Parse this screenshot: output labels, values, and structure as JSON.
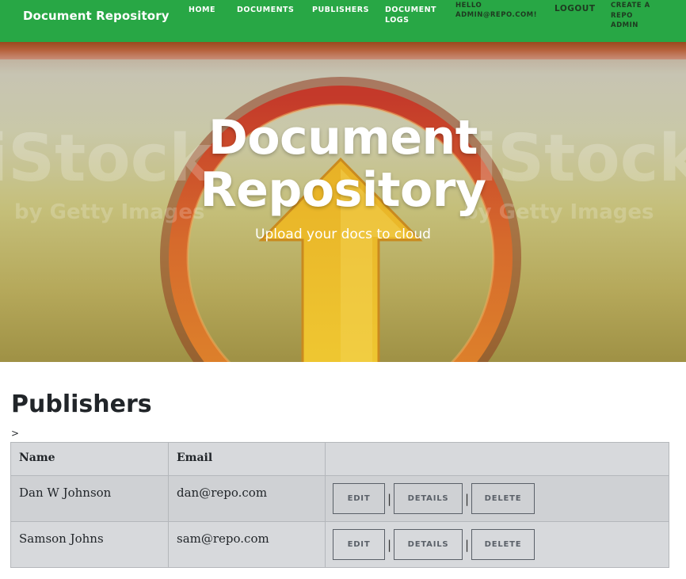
{
  "navbar": {
    "brand": "Document Repository",
    "home": "HOME",
    "documents": "DOCUMENTS",
    "publishers": "PUBLISHERS",
    "document_logs": "DOCUMENT LOGS",
    "hello": "HELLO ADMIN@REPO.COM!",
    "logout": "LOGOUT",
    "create_admin": "CREATE A REPO ADMIN",
    "color": "#28a745"
  },
  "hero": {
    "title_line1": "Document",
    "title_line2": "Repository",
    "subtitle": "Upload your docs to cloud",
    "watermark_left": "iStock",
    "watermark_right": "iStock",
    "watermark_sub_left": "by Getty Images",
    "watermark_sub_right": "by Getty Images"
  },
  "page": {
    "title": "Publishers",
    "stray_text": ">"
  },
  "table": {
    "headers": [
      "Name",
      "Email",
      ""
    ],
    "rows": [
      {
        "name": "Dan W Johnson",
        "email": "dan@repo.com"
      },
      {
        "name": "Samson Johns",
        "email": "sam@repo.com"
      }
    ],
    "actions": {
      "edit": "EDIT",
      "details": "DETAILS",
      "delete": "DELETE",
      "separator": "|"
    }
  }
}
